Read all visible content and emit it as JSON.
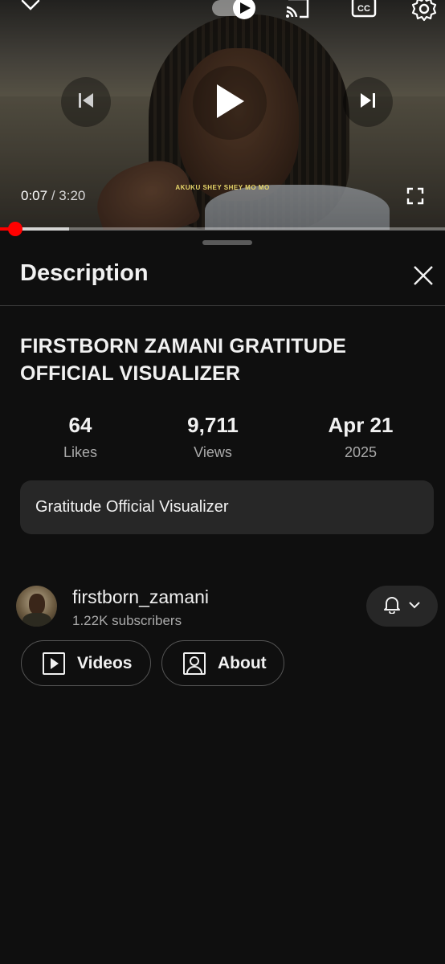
{
  "player": {
    "current_time": "0:07",
    "separator": "/",
    "duration": "3:20",
    "subtitle_text": "AKUKU SHEY SHEY MO MO",
    "progress_fraction": 0.035,
    "buffered_fraction": 0.155,
    "icons": [
      "chevron-down-icon",
      "autoplay-toggle-icon",
      "cast-icon",
      "closed-captions-icon",
      "settings-icon",
      "previous-icon",
      "play-icon",
      "next-icon",
      "fullscreen-icon"
    ]
  },
  "panel": {
    "title": "Description",
    "close_icon": "close-icon"
  },
  "video": {
    "title": "FIRSTBORN ZAMANI GRATITUDE OFFICIAL VISUALIZER",
    "description": "Gratitude Official Visualizer"
  },
  "stats": {
    "likes_value": "64",
    "likes_label": "Likes",
    "views_value": "9,711",
    "views_label": "Views",
    "date_value": "Apr 21",
    "date_year": "2025"
  },
  "channel": {
    "name": "firstborn_zamani",
    "subscribers": "1.22K subscribers",
    "videos_label": "Videos",
    "about_label": "About"
  },
  "colors": {
    "background": "#0f0f0f",
    "surface": "#272727",
    "accent_red": "#ff0000",
    "text_primary": "#f1f1f1",
    "text_secondary": "#aaaaaa"
  }
}
